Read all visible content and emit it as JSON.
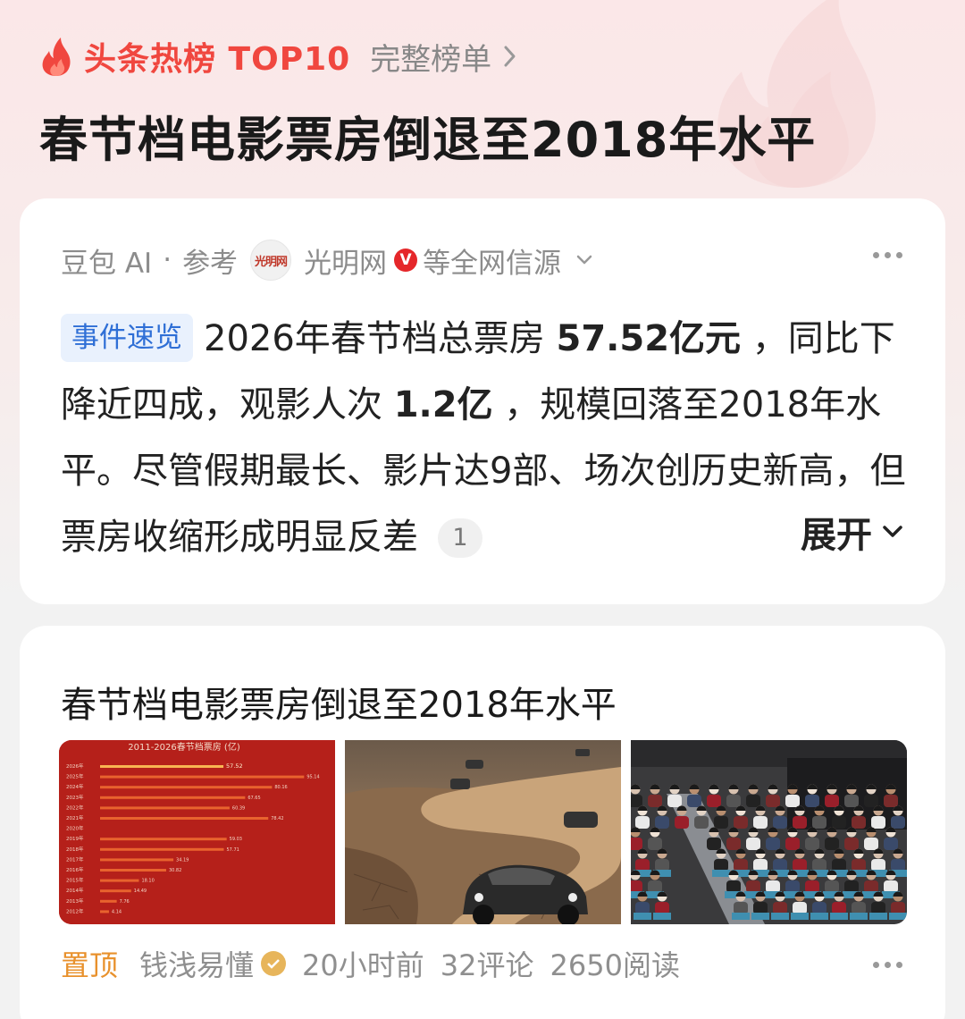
{
  "header": {
    "hot_title": "头条热榜 TOP10",
    "full_list_label": "完整榜单",
    "main_title": "春节档电影票房倒退至2018年水平"
  },
  "source": {
    "provider": "豆包 AI",
    "dot": "·",
    "ref_label": "参考",
    "logo_text": "光明网",
    "outlet": "光明网",
    "badge": "V",
    "suffix": "等全网信源"
  },
  "summary": {
    "tag": "事件速览",
    "part1": "2026年春节档总票房 ",
    "bold1": "57.52亿元",
    "part2": " ，同比下降近四成，观影人次 ",
    "bold2": "1.2亿",
    "part3": " ，规模回落至2018年水平。尽管假期最长、影片达9部、场次创历史新高，但票房收缩形成明显反差",
    "ref_number": "1",
    "expand_label": "展开"
  },
  "article": {
    "title": "春节档电影票房倒退至2018年水平",
    "chart_thumb_title": "2011-2026春节档票房 (亿)",
    "pin_label": "置顶",
    "author": "钱浅易懂",
    "time": "20小时前",
    "comments": "32评论",
    "reads": "2650阅读"
  },
  "chart_data": {
    "type": "bar",
    "title": "2011-2026春节档票房 (亿)",
    "categories": [
      "2026年",
      "2025年",
      "2024年",
      "2023年",
      "2022年",
      "2021年",
      "2020年",
      "2019年",
      "2018年",
      "2017年",
      "2016年",
      "2015年",
      "2014年",
      "2013年",
      "2012年"
    ],
    "values": [
      57.52,
      95.14,
      80.16,
      67.65,
      60.39,
      78.42,
      0,
      59.03,
      57.71,
      34.19,
      30.82,
      18.1,
      14.49,
      7.76,
      4.14
    ],
    "xlim": [
      0,
      100
    ]
  },
  "colors": {
    "accent": "#f0473f",
    "pin": "#e8912c",
    "tag_blue": "#2f6fd6"
  }
}
